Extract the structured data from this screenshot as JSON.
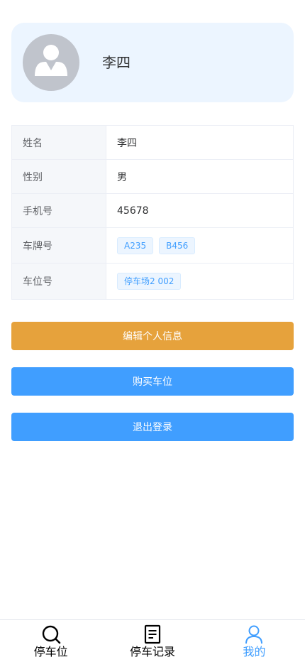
{
  "profile": {
    "name": "李四",
    "avatar_icon": "user-avatar-icon"
  },
  "info": {
    "rows": [
      {
        "label": "姓名",
        "value": "李四"
      },
      {
        "label": "性别",
        "value": "男"
      },
      {
        "label": "手机号",
        "value": "45678"
      },
      {
        "label": "车牌号",
        "tags": [
          "A235",
          "B456"
        ]
      },
      {
        "label": "车位号",
        "tags": [
          "停车场2 002"
        ]
      }
    ]
  },
  "actions": {
    "edit_label": "编辑个人信息",
    "buy_label": "购买车位",
    "logout_label": "退出登录"
  },
  "nav": {
    "items": [
      {
        "label": "停车位",
        "icon": "search-icon"
      },
      {
        "label": "停车记录",
        "icon": "document-icon"
      },
      {
        "label": "我的",
        "icon": "user-icon",
        "active": true
      }
    ]
  },
  "colors": {
    "primary": "#409eff",
    "warning": "#e6a23c",
    "card_bg": "#ecf5ff",
    "avatar_bg": "#c0c4cc",
    "label_bg": "#f5f7fa",
    "border": "#ebeef5"
  }
}
